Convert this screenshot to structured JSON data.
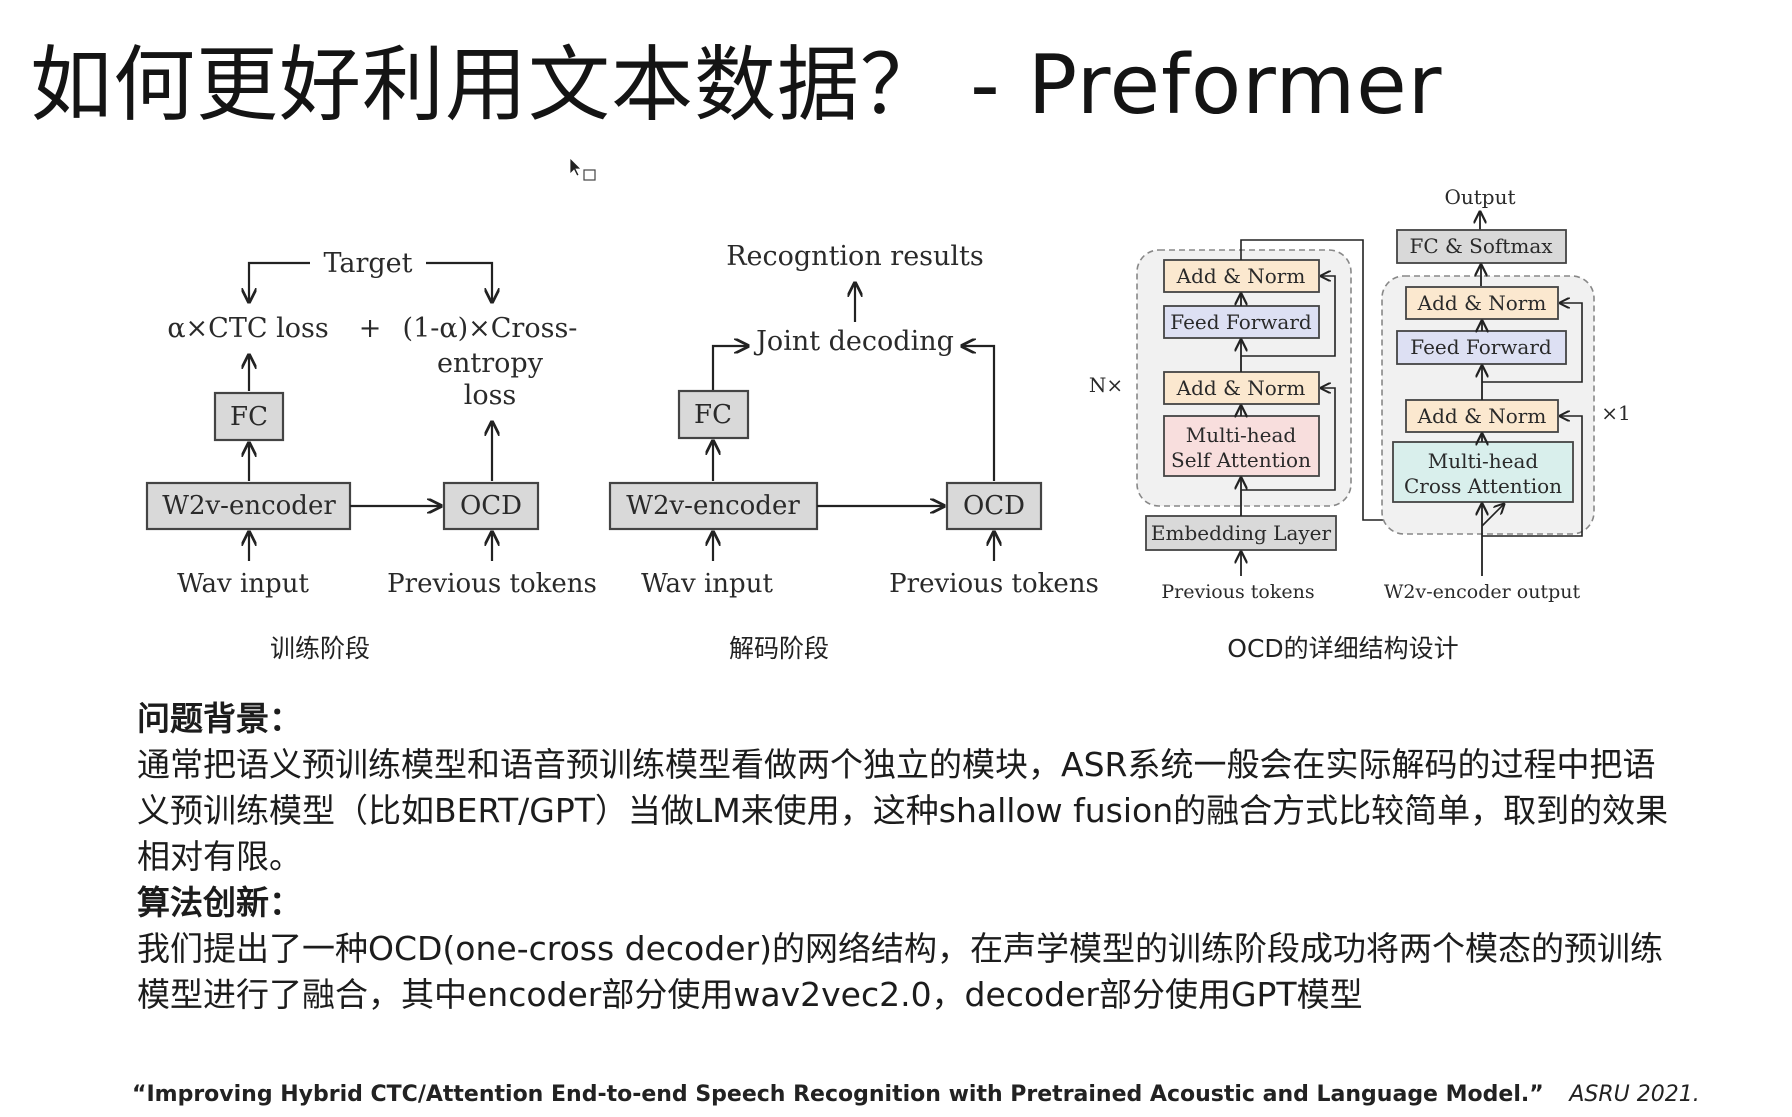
{
  "slide": {
    "title": "如何更好利用文本数据？ - Preformer"
  },
  "training_diagram": {
    "target": "Target",
    "ctc_loss": "α×CTC loss",
    "plus": "+",
    "ce_loss_line1": "(1-α)×Cross-",
    "ce_loss_line2": "entropy",
    "ce_loss_line3": "loss",
    "fc": "FC",
    "encoder": "W2v-encoder",
    "ocd": "OCD",
    "wav_input": "Wav input",
    "previous_tokens": "Previous tokens",
    "caption": "训练阶段"
  },
  "decoding_diagram": {
    "results": "Recogntion results",
    "joint_decoding": "Joint decoding",
    "fc": "FC",
    "encoder": "W2v-encoder",
    "ocd": "OCD",
    "wav_input": "Wav input",
    "previous_tokens": "Previous tokens",
    "caption": "解码阶段"
  },
  "ocd_diagram": {
    "output": "Output",
    "fc_softmax": "FC & Softmax",
    "add_norm": "Add & Norm",
    "feed_forward": "Feed Forward",
    "self_attention_line1": "Multi-head",
    "self_attention_line2": "Self Attention",
    "cross_attention_line1": "Multi-head",
    "cross_attention_line2": "Cross Attention",
    "embedding_layer": "Embedding Layer",
    "previous_tokens": "Previous tokens",
    "encoder_output": "W2v-encoder output",
    "n_times": "N×",
    "times_one": "×1",
    "caption": "OCD的详细结构设计"
  },
  "description": {
    "background_heading": "问题背景：",
    "background_text": "通常把语义预训练模型和语音预训练模型看做两个独立的模块，ASR系统一般会在实际解码的过程中把语义预训练模型（比如BERT/GPT）当做LM来使用，这种shallow fusion的融合方式比较简单，取到的效果相对有限。",
    "innovation_heading": "算法创新：",
    "innovation_text": "我们提出了一种OCD(one-cross decoder)的网络结构，在声学模型的训练阶段成功将两个模态的预训练模型进行了融合，其中encoder部分使用wav2vec2.0，decoder部分使用GPT模型"
  },
  "reference": {
    "citation": "“Improving Hybrid CTC/Attention End-to-end Speech Recognition with Pretrained Acoustic and Language Model.”",
    "venue": "ASRU 2021."
  },
  "colors": {
    "box_gray": "#d9d9d9",
    "add_norm_fill": "#fbe8cf",
    "feed_forward_fill": "#dde0f3",
    "self_attention_fill": "#f8dedd",
    "cross_attention_fill": "#d9efec",
    "block_bg": "#f1f1f1"
  }
}
